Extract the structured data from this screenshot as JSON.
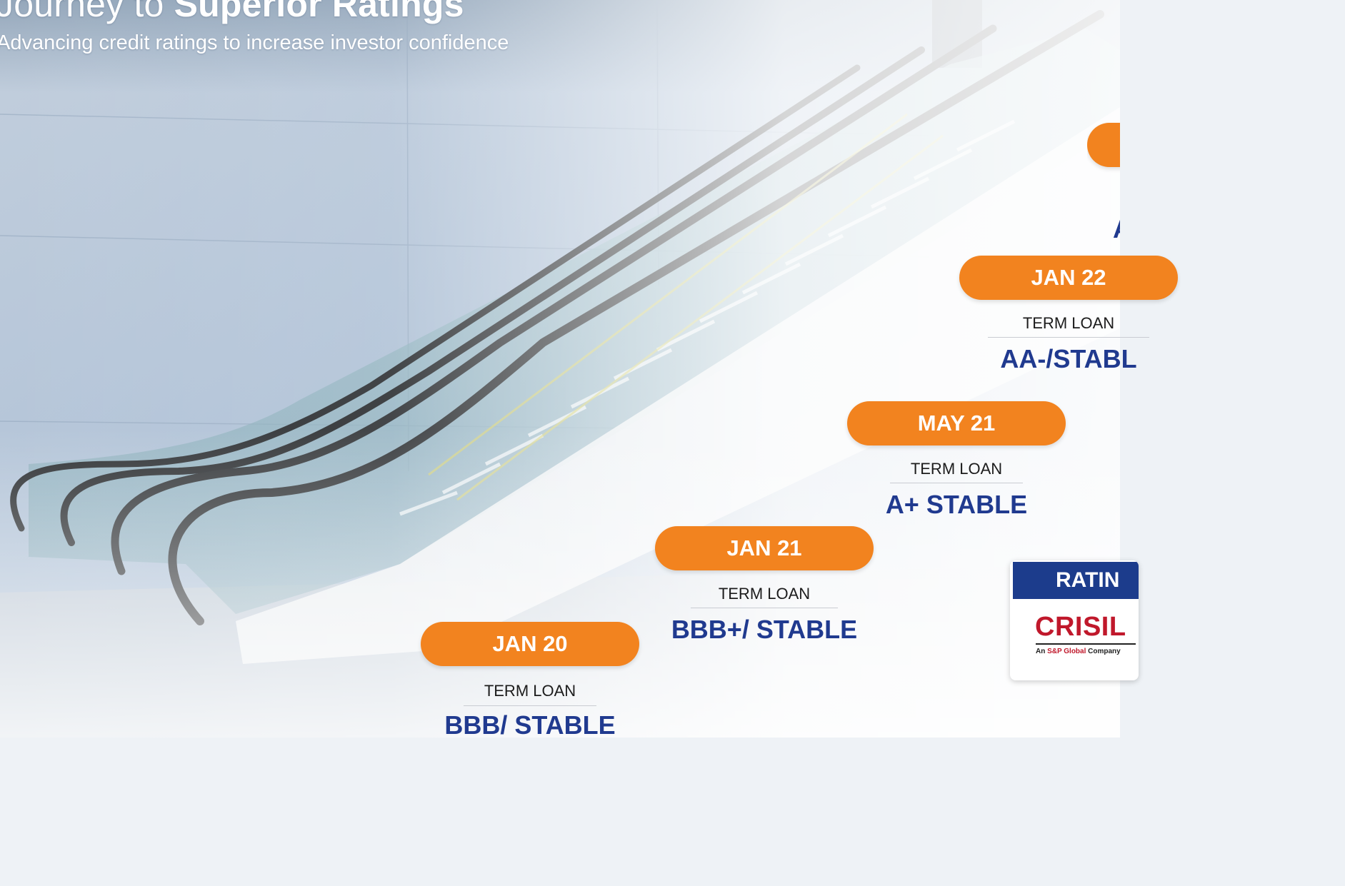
{
  "header": {
    "title_regular": "Journey to ",
    "title_bold": "Superior Ratings",
    "subtitle": "Advancing credit ratings to increase investor confidence"
  },
  "milestones": [
    {
      "date": "JAN 20",
      "instrument": "TERM LOAN",
      "rating": "BBB/ STABLE"
    },
    {
      "date": "JAN 21",
      "instrument": "TERM LOAN",
      "rating": "BBB+/ STABLE"
    },
    {
      "date": "MAY 21",
      "instrument": "TERM LOAN",
      "rating": "A+ STABLE"
    },
    {
      "date": "JAN 22",
      "instrument": "TERM LOAN",
      "rating": "AA-/STABL"
    },
    {
      "date": "",
      "instrument": "",
      "rating": "A"
    }
  ],
  "agency": {
    "heading": "RATIN",
    "name": "CRISIL",
    "tagline_prefix": "An ",
    "tagline_brand": "S&P Global",
    "tagline_suffix": " Company"
  },
  "colors": {
    "accent_orange": "#f2831f",
    "rating_blue": "#203a8f",
    "agency_blue": "#1c3c8c",
    "crisil_red": "#c0182b"
  }
}
